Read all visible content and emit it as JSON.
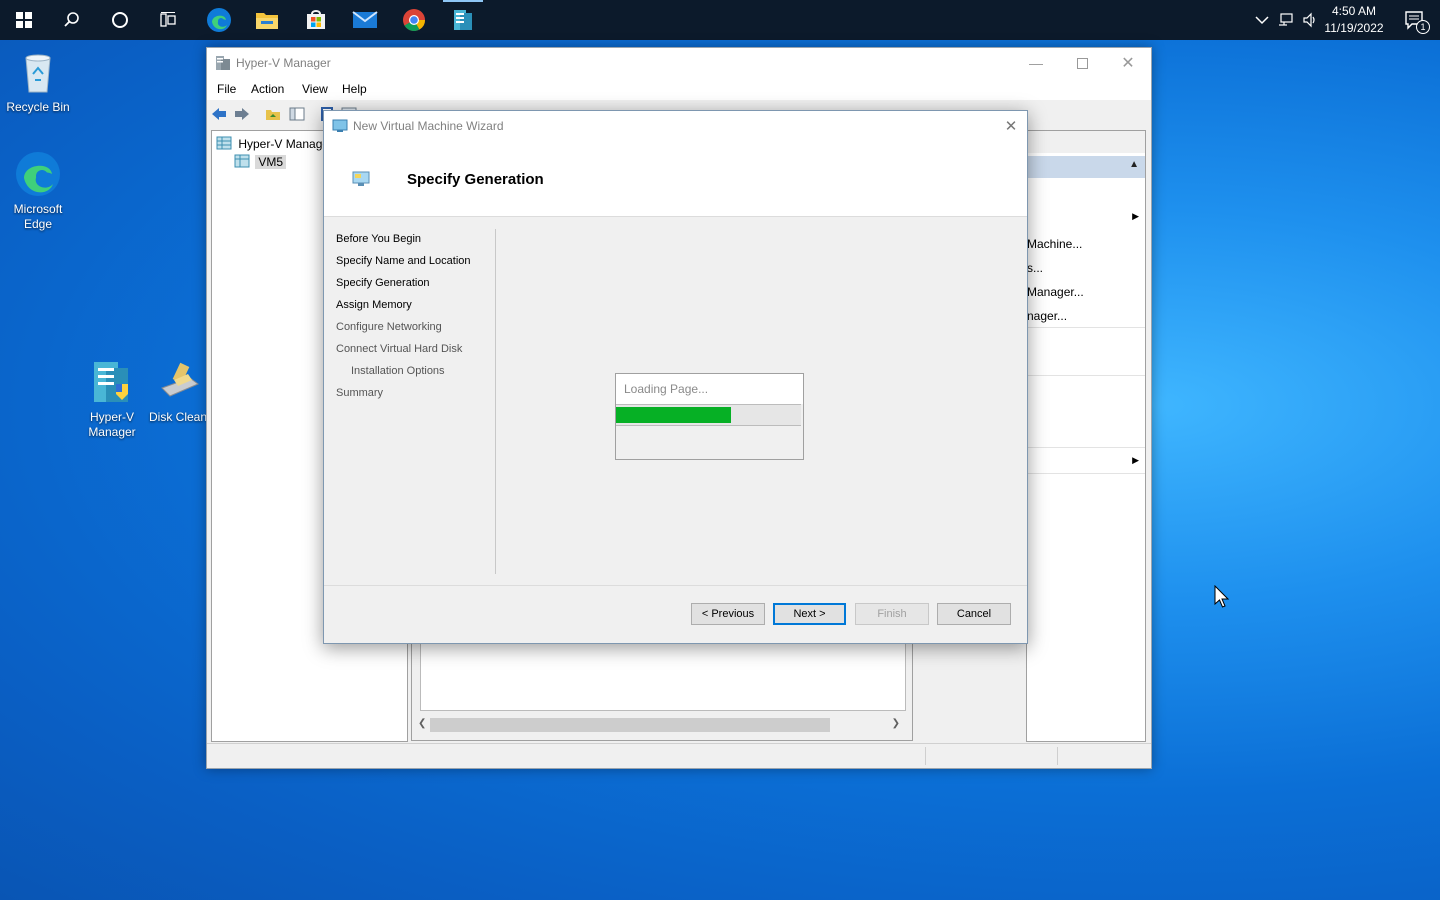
{
  "taskbar": {
    "buttons": [
      "start-icon",
      "search-icon",
      "cortana-icon",
      "task-view-icon",
      "edge-icon",
      "file-explorer-icon",
      "store-icon",
      "mail-icon",
      "chrome-icon",
      "hyperv-manager-icon"
    ],
    "clock": {
      "time": "4:50 AM",
      "date": "11/19/2022"
    },
    "notifications_count": "1"
  },
  "desktop": {
    "icons": [
      {
        "label": "Recycle Bin"
      },
      {
        "label": "Microsoft Edge"
      },
      {
        "label": "Hyper-V Manager"
      },
      {
        "label": "Disk Clean"
      }
    ]
  },
  "hyperv": {
    "title": "Hyper-V Manager",
    "menu": [
      "File",
      "Action",
      "View",
      "Help"
    ],
    "tree": {
      "root": "Hyper-V Manage",
      "child": "VM5"
    },
    "actions": [
      "Machine...",
      "s...",
      "Manager...",
      "nager..."
    ]
  },
  "wizard": {
    "title": "New Virtual Machine Wizard",
    "heading": "Specify Generation",
    "steps": [
      "Before You Begin",
      "Specify Name and Location",
      "Specify Generation",
      "Assign Memory",
      "Configure Networking",
      "Connect Virtual Hard Disk",
      "Installation Options",
      "Summary"
    ],
    "loading": {
      "text": "Loading Page...",
      "progress": 0.62
    },
    "buttons": {
      "previous": "< Previous",
      "next": "Next >",
      "finish": "Finish",
      "cancel": "Cancel"
    }
  },
  "colors": {
    "progress": "#06b025",
    "accent": "#0078d7",
    "taskbar": "#0c1a2b"
  }
}
